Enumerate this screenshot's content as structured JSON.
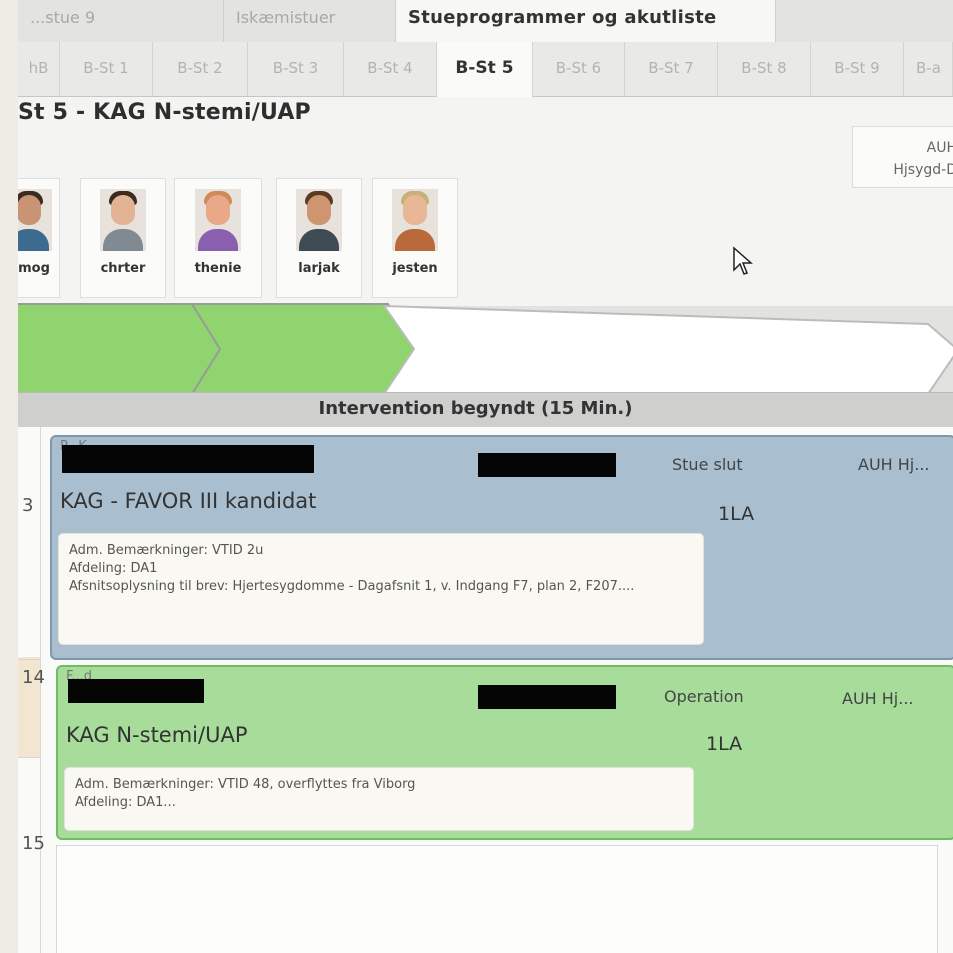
{
  "top_tabs": [
    "...stue 9",
    "Iskæmistuer",
    "Stueprogrammer og akutliste"
  ],
  "room_tabs": [
    "hB",
    "B-St 1",
    "B-St 2",
    "B-St 3",
    "B-St 4",
    "B-St 5",
    "B-St 6",
    "B-St 7",
    "B-St 8",
    "B-St 9",
    "B-a"
  ],
  "page_title": "St 5 - KAG N-stemi/UAP",
  "org_box": {
    "line1": "AUH",
    "line2": "Hjsygd-D"
  },
  "staff": [
    {
      "name": "mog"
    },
    {
      "name": "chrter"
    },
    {
      "name": "thenie"
    },
    {
      "name": "larjak"
    },
    {
      "name": "jesten"
    }
  ],
  "status_text": "Intervention begyndt (15 Min.)",
  "hours": [
    "3",
    "14",
    "15"
  ],
  "bookings": [
    {
      "ghost_label": "P...K...",
      "status": "Stue slut",
      "org": "AUH Hj...",
      "procedure": "KAG - FAVOR III kandidat",
      "anesthesia": "1LA",
      "notes": [
        "Adm. Bemærkninger: VTID 2u",
        "Afdeling: DA1",
        "Afsnitsoplysning til brev: Hjertesygdomme - Dagafsnit 1, v. Indgang F7, plan 2, F207...."
      ]
    },
    {
      "ghost_label": "F...d",
      "status": "Operation",
      "org": "AUH Hj...",
      "procedure": "KAG N-stemi/UAP",
      "anesthesia": "1LA",
      "notes": [
        "Adm. Bemærkninger: VTID 48, overflyttes fra Viborg",
        "Afdeling: DA1..."
      ]
    }
  ],
  "colors": {
    "stage_done": "#8fd46f",
    "card_done": "#a9bfd0",
    "card_active": "#a7dc9a"
  }
}
